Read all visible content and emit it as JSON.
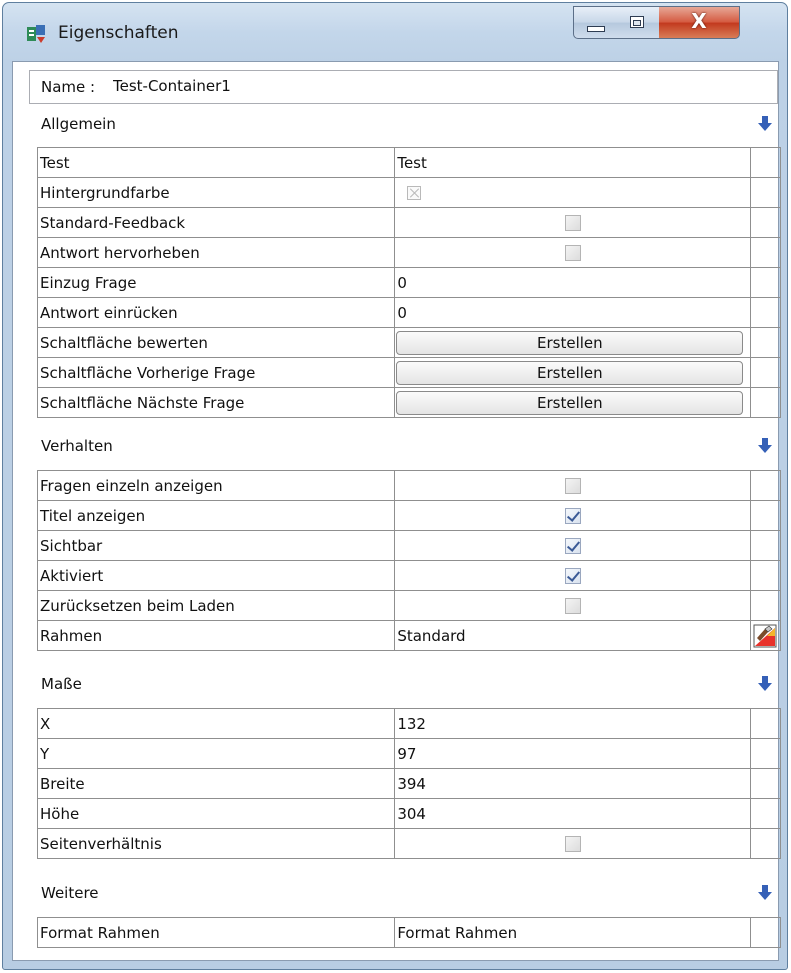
{
  "window": {
    "title": "Eigenschaften",
    "controls": {
      "close_symbol": "X"
    }
  },
  "name_field": {
    "label": "Name :",
    "value": "Test-Container1"
  },
  "sections": [
    {
      "title": "Allgemein",
      "rows": [
        {
          "label": "Test",
          "value": "Test"
        },
        {
          "label": "Hintergrundfarbe",
          "value": "",
          "control": "disabled-checkbox"
        },
        {
          "label": "Standard-Feedback",
          "value": "",
          "control": "checkbox",
          "checked": false
        },
        {
          "label": "Antwort hervorheben",
          "value": "",
          "control": "checkbox",
          "checked": false
        },
        {
          "label": "Einzug Frage",
          "value": "0"
        },
        {
          "label": "Antwort einrücken",
          "value": "0"
        },
        {
          "label": "Schaltfläche bewerten",
          "value": "Erstellen",
          "control": "button"
        },
        {
          "label": "Schaltfläche Vorherige Frage",
          "value": "Erstellen",
          "control": "button"
        },
        {
          "label": "Schaltfläche Nächste Frage",
          "value": "Erstellen",
          "control": "button"
        }
      ]
    },
    {
      "title": "Verhalten",
      "rows": [
        {
          "label": "Fragen einzeln anzeigen",
          "value": "",
          "control": "checkbox",
          "checked": false
        },
        {
          "label": "Titel anzeigen",
          "value": "",
          "control": "checkbox",
          "checked": true
        },
        {
          "label": "Sichtbar",
          "value": "",
          "control": "checkbox",
          "checked": true
        },
        {
          "label": "Aktiviert",
          "value": "",
          "control": "checkbox",
          "checked": true
        },
        {
          "label": "Zurücksetzen beim Laden",
          "value": "",
          "control": "checkbox",
          "checked": false
        },
        {
          "label": "Rahmen",
          "value": "Standard",
          "icon": "paint-brush-icon"
        }
      ]
    },
    {
      "title": "Maße",
      "rows": [
        {
          "label": "X",
          "value": "132"
        },
        {
          "label": "Y",
          "value": "97"
        },
        {
          "label": "Breite",
          "value": "394"
        },
        {
          "label": "Höhe",
          "value": "304"
        },
        {
          "label": "Seitenverhältnis",
          "value": "",
          "control": "checkbox",
          "checked": false
        }
      ]
    },
    {
      "title": "Weitere",
      "rows": [
        {
          "label": "Format Rahmen",
          "value": "Format Rahmen"
        }
      ]
    }
  ],
  "icons": {
    "app": "properties-app-icon",
    "section_toggle": "blue-down-arrow-icon"
  }
}
